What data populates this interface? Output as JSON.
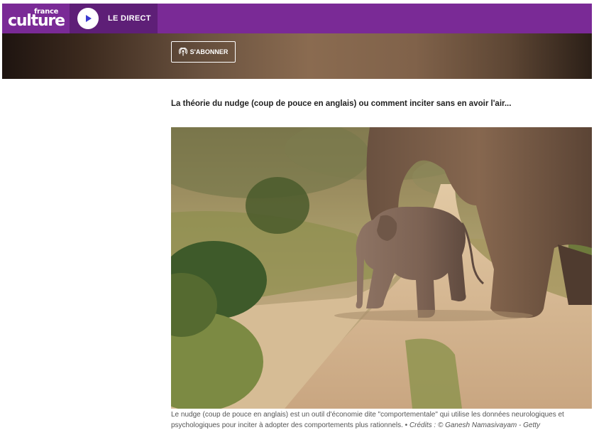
{
  "header": {
    "logo_small": "france",
    "logo_big": "culture",
    "live_label": "LE DIRECT",
    "subscribe_label": "S'ABONNER"
  },
  "article": {
    "headline": "La théorie du nudge (coup de pouce en anglais) ou comment inciter sans en avoir l'air...",
    "caption": "Le nudge (coup de pouce en anglais) est un outil d'économie dite \"comportementale\" qui utilise les données neurologiques et psychologiques pour inciter à adopter des comportements plus rationnels.",
    "separator": "•",
    "credit": "Crédits : © Ganesh Namasivayam - Getty"
  },
  "colors": {
    "brand_purple": "#7a2a96",
    "live_purple": "#5e1f77"
  },
  "icons": {
    "play": "play-icon",
    "podcast": "podcast-icon"
  }
}
